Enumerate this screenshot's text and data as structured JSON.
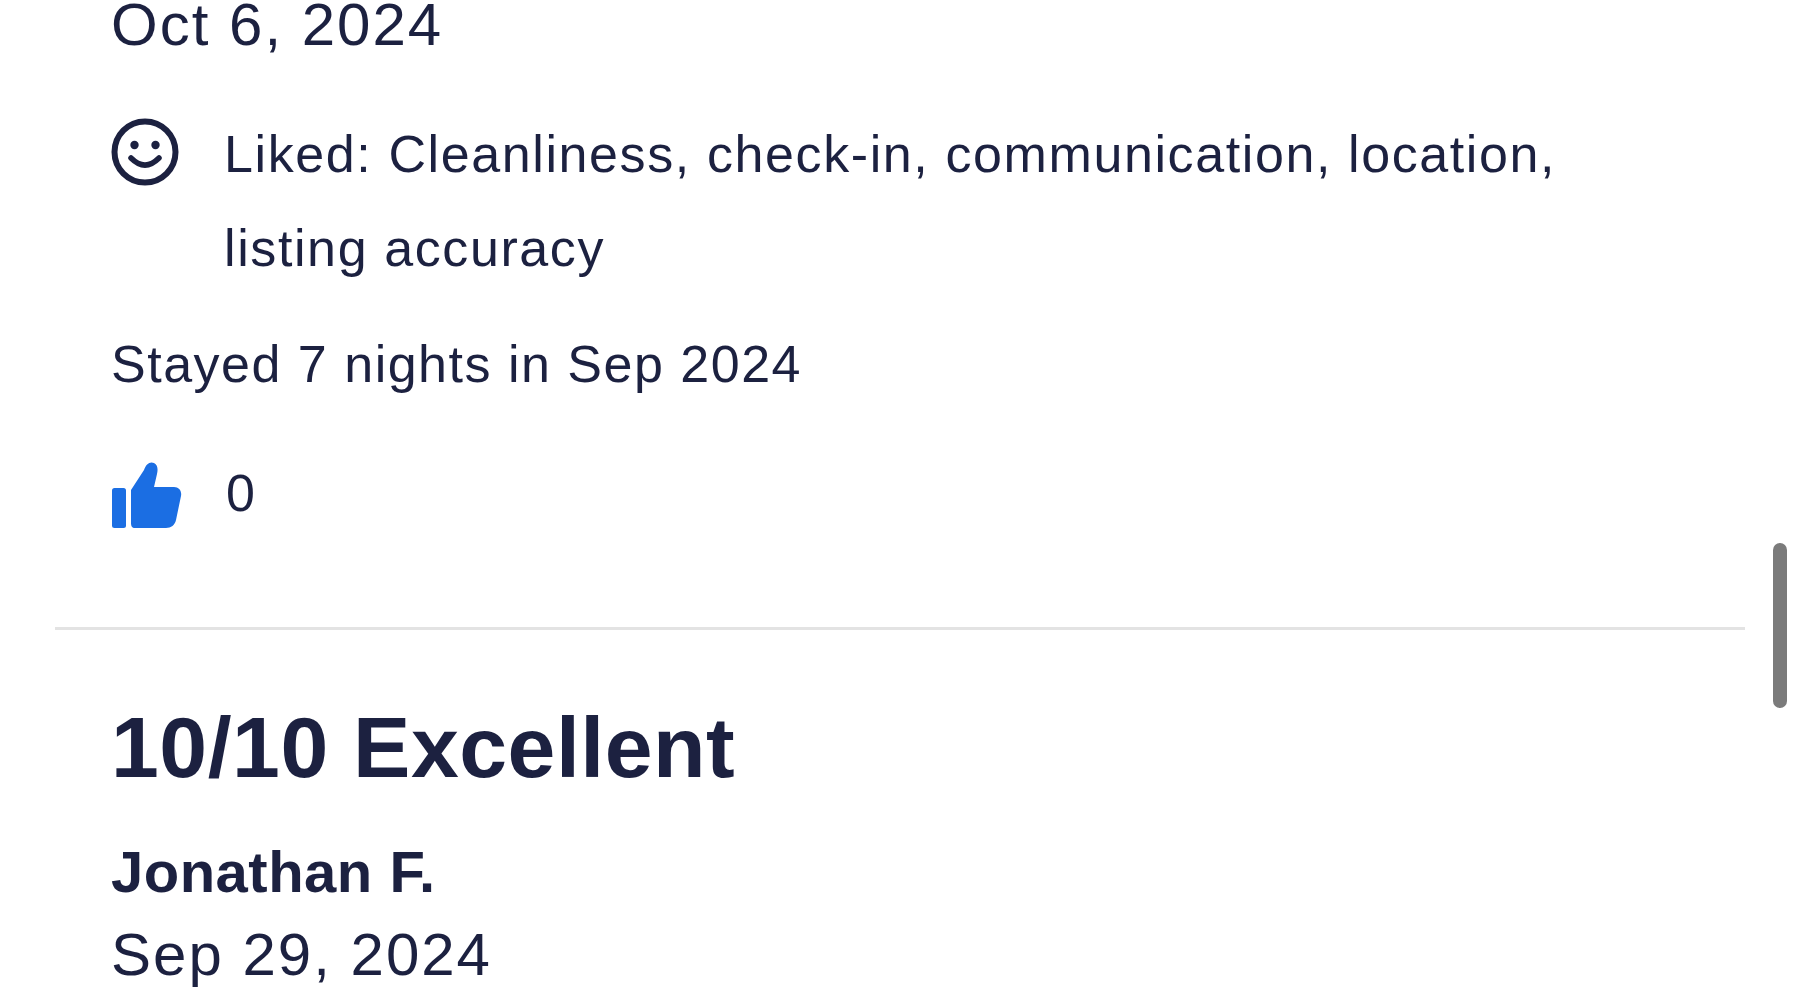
{
  "reviews": [
    {
      "date": "Oct 6, 2024",
      "liked": "Liked: Cleanliness, check-in, communication, location, listing accuracy",
      "stay": "Stayed 7 nights in Sep 2024",
      "helpful_count": "0"
    },
    {
      "rating": "10/10 Excellent",
      "author": "Jonathan F.",
      "date": "Sep 29, 2024"
    }
  ]
}
